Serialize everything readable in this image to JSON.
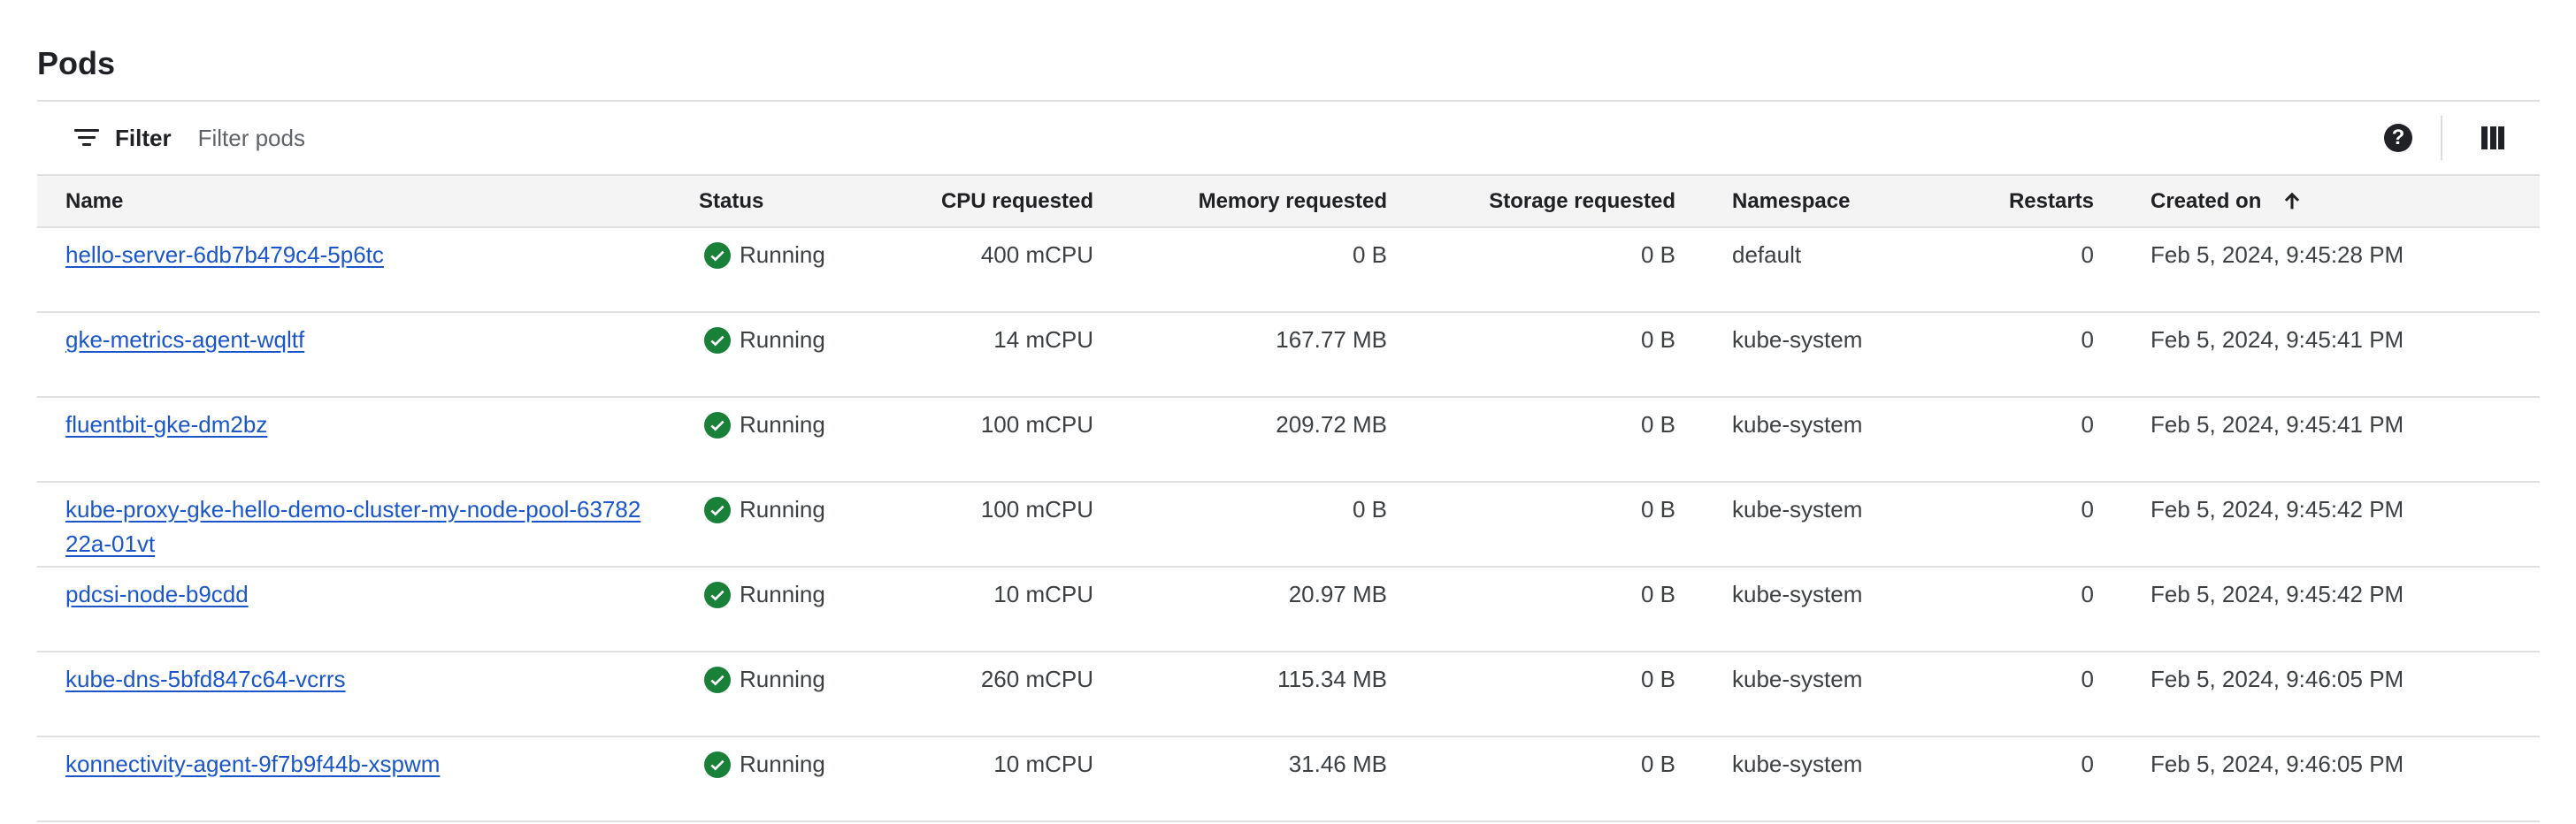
{
  "page": {
    "title": "Pods"
  },
  "toolbar": {
    "filter_label": "Filter",
    "filter_placeholder": "Filter pods",
    "filter_value": "",
    "help_icon": "help-icon",
    "columns_icon": "column-display-icon"
  },
  "table": {
    "headers": {
      "name": "Name",
      "status": "Status",
      "cpu": "CPU requested",
      "memory": "Memory requested",
      "storage": "Storage requested",
      "namespace": "Namespace",
      "restarts": "Restarts",
      "created": "Created on"
    },
    "sort": {
      "column": "created",
      "direction": "ascending",
      "icon": "arrow-up-icon"
    },
    "rows": [
      {
        "name": "hello-server-6db7b479c4-5p6tc",
        "status": "Running",
        "cpu": "400 mCPU",
        "memory": "0 B",
        "storage": "0 B",
        "namespace": "default",
        "restarts": "0",
        "created": "Feb 5, 2024, 9:45:28 PM"
      },
      {
        "name": "gke-metrics-agent-wqltf",
        "status": "Running",
        "cpu": "14 mCPU",
        "memory": "167.77 MB",
        "storage": "0 B",
        "namespace": "kube-system",
        "restarts": "0",
        "created": "Feb 5, 2024, 9:45:41 PM"
      },
      {
        "name": "fluentbit-gke-dm2bz",
        "status": "Running",
        "cpu": "100 mCPU",
        "memory": "209.72 MB",
        "storage": "0 B",
        "namespace": "kube-system",
        "restarts": "0",
        "created": "Feb 5, 2024, 9:45:41 PM"
      },
      {
        "name": "kube-proxy-gke-hello-demo-cluster-my-node-pool-6378222a-01vt",
        "status": "Running",
        "cpu": "100 mCPU",
        "memory": "0 B",
        "storage": "0 B",
        "namespace": "kube-system",
        "restarts": "0",
        "created": "Feb 5, 2024, 9:45:42 PM"
      },
      {
        "name": "pdcsi-node-b9cdd",
        "status": "Running",
        "cpu": "10 mCPU",
        "memory": "20.97 MB",
        "storage": "0 B",
        "namespace": "kube-system",
        "restarts": "0",
        "created": "Feb 5, 2024, 9:45:42 PM"
      },
      {
        "name": "kube-dns-5bfd847c64-vcrrs",
        "status": "Running",
        "cpu": "260 mCPU",
        "memory": "115.34 MB",
        "storage": "0 B",
        "namespace": "kube-system",
        "restarts": "0",
        "created": "Feb 5, 2024, 9:46:05 PM"
      },
      {
        "name": "konnectivity-agent-9f7b9f44b-xspwm",
        "status": "Running",
        "cpu": "10 mCPU",
        "memory": "31.46 MB",
        "storage": "0 B",
        "namespace": "kube-system",
        "restarts": "0",
        "created": "Feb 5, 2024, 9:46:05 PM"
      }
    ]
  },
  "colors": {
    "link": "#1a56c9",
    "status_running": "#188038",
    "header_bg": "#f4f4f4",
    "border": "#e0e0e0",
    "text": "#202124"
  }
}
